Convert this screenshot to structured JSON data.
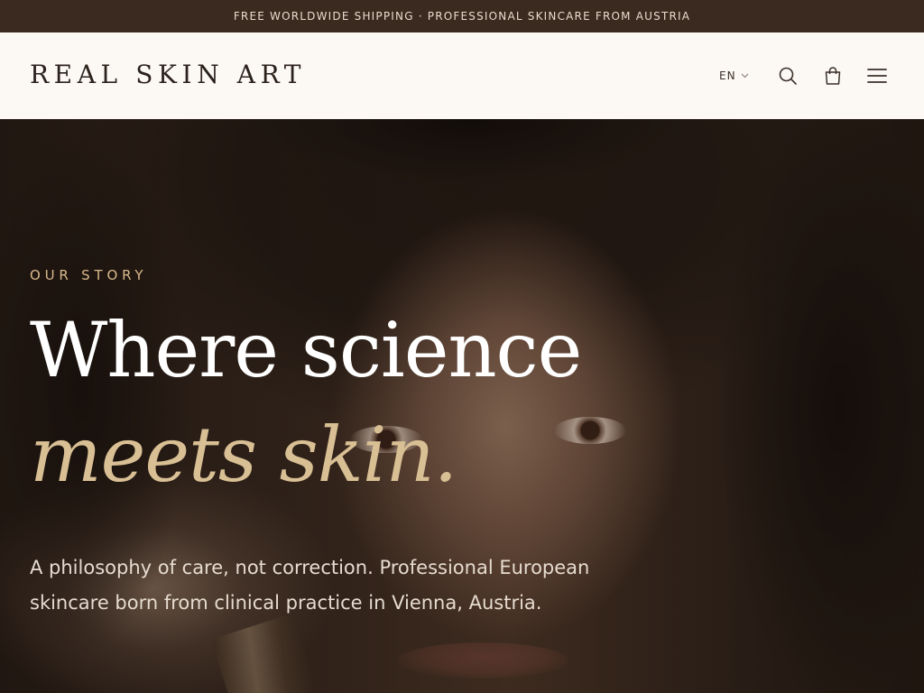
{
  "announcement": "FREE WORLDWIDE SHIPPING · PROFESSIONAL SKINCARE FROM AUSTRIA",
  "header": {
    "logo": "REAL SKIN ART",
    "language": "EN",
    "icons": [
      "search-icon",
      "shopping-bag-icon",
      "menu-icon"
    ]
  },
  "hero": {
    "eyebrow": "OUR STORY",
    "headline_line1": "Where science",
    "headline_line2": "meets skin.",
    "description": "A philosophy of care, not correction. Professional European skincare born from clinical practice in Vienna, Austria."
  },
  "colors": {
    "announcement_bg": "#3b2a1f",
    "header_bg": "#fcf8f3",
    "accent_gold": "#d9bf94",
    "text_dark": "#2b221c"
  }
}
